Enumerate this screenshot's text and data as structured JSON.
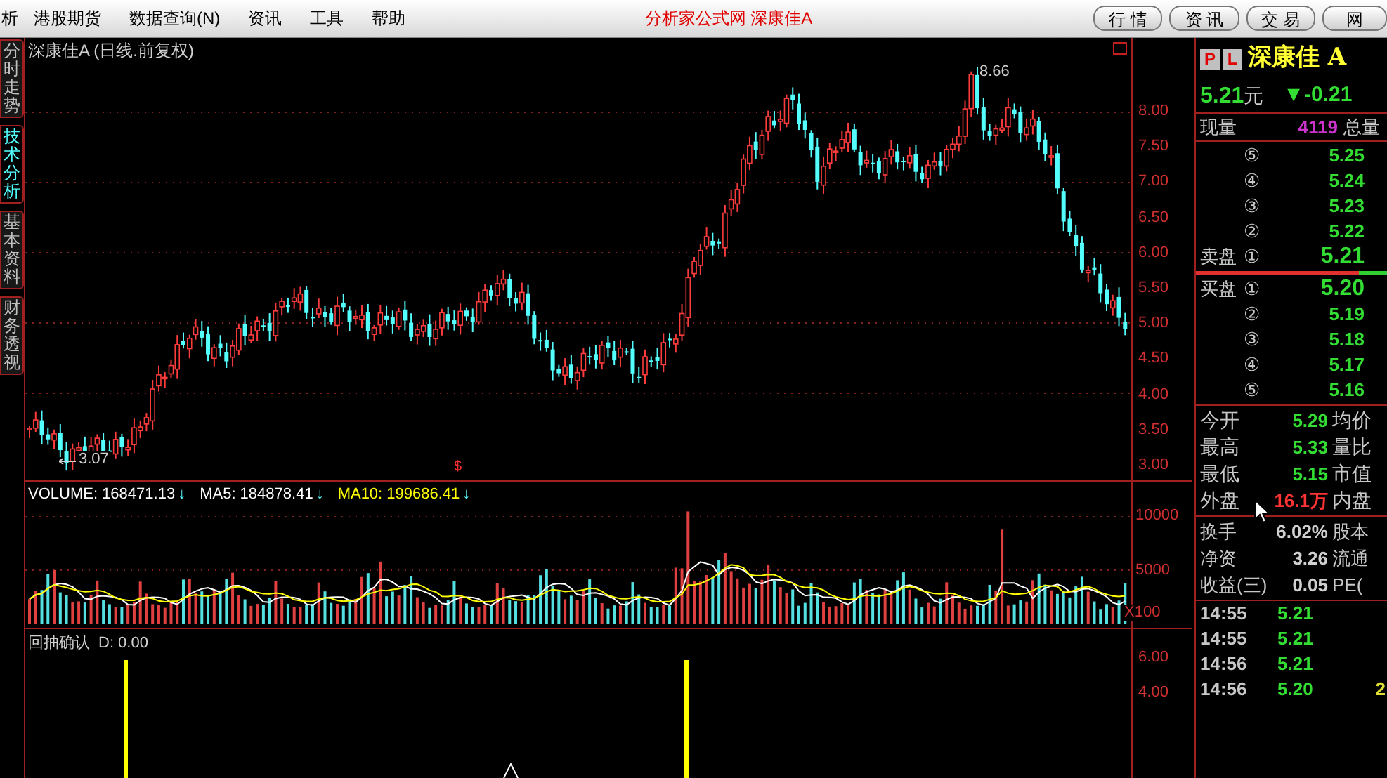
{
  "menu_bar": {
    "items": [
      "析",
      "港股期货",
      "数据查询(N)",
      "资讯",
      "工具",
      "帮助"
    ],
    "title": "分析家公式网 深康佳A",
    "buttons": [
      "行 情",
      "资 讯",
      "交 易",
      "网"
    ]
  },
  "side_tabs": [
    {
      "label": "分时走势",
      "selected": false
    },
    {
      "label": "技术分析",
      "selected": true
    },
    {
      "label": "基本资料",
      "selected": false
    },
    {
      "label": "财务透视",
      "selected": false
    }
  ],
  "price_chart": {
    "title": "深康佳A (日线.前复权)",
    "axis_labels": [
      "8.00",
      "7.50",
      "7.00",
      "6.50",
      "6.00",
      "5.50",
      "5.00",
      "4.50",
      "4.00",
      "3.50",
      "3.00"
    ],
    "high_label": "8.66",
    "low_label": "3.07",
    "marker": "$"
  },
  "volume_pane": {
    "legend": [
      {
        "text": "VOLUME: 168471.13",
        "color": "#ffffff",
        "arrow": "↓"
      },
      {
        "text": "MA5: 184878.41",
        "color": "#ffffff",
        "arrow": "↓"
      },
      {
        "text": "MA10: 199686.41",
        "color": "#ffff00",
        "arrow": "↓"
      }
    ],
    "axis_labels": [
      "10000",
      "5000"
    ],
    "unit": "X100"
  },
  "indicator_pane": {
    "name": "回抽确认",
    "legend": "D: 0.00",
    "axis_labels": [
      "6.00",
      "4.00"
    ]
  },
  "quote_panel": {
    "badges": [
      "P",
      "L"
    ],
    "name": "深康佳 A",
    "price": "5.21",
    "currency": "元",
    "change": "▼-0.21",
    "volume_row": {
      "label": "现量",
      "value": "4119",
      "label2": "总量"
    },
    "sells": [
      {
        "num": "⑤",
        "price": "5.25"
      },
      {
        "num": "④",
        "price": "5.24"
      },
      {
        "num": "③",
        "price": "5.23"
      },
      {
        "num": "②",
        "price": "5.22"
      },
      {
        "label": "卖盘",
        "num": "①",
        "price": "5.21"
      }
    ],
    "balance_bar": {
      "level": 0.85
    },
    "buys": [
      {
        "label": "买盘",
        "num": "①",
        "price": "5.20"
      },
      {
        "num": "②",
        "price": "5.19"
      },
      {
        "num": "③",
        "price": "5.18"
      },
      {
        "num": "④",
        "price": "5.17"
      },
      {
        "num": "⑤",
        "price": "5.16"
      }
    ],
    "stats": [
      {
        "label": "今开",
        "value": "5.29",
        "color": "#33dd33",
        "label2": "均价"
      },
      {
        "label": "最高",
        "value": "5.33",
        "color": "#33dd33",
        "label2": "量比"
      },
      {
        "label": "最低",
        "value": "5.15",
        "color": "#33dd33",
        "label2": "市值"
      },
      {
        "label": "外盘",
        "value": "16.1万",
        "color": "#ff3333",
        "label2": "内盘"
      }
    ],
    "stats2": [
      {
        "label": "换手",
        "value": "6.02%",
        "label2": "股本"
      },
      {
        "label": "净资",
        "value": "3.26",
        "label2": "流通"
      },
      {
        "label": "收益(三)",
        "value": "0.05",
        "label2": "PE("
      }
    ],
    "ticks": [
      {
        "time": "14:55",
        "price": "5.21"
      },
      {
        "time": "14:55",
        "price": "5.21"
      },
      {
        "time": "14:56",
        "price": "5.21"
      },
      {
        "time": "14:56",
        "price": "5.20",
        "volume": "2"
      }
    ]
  }
}
